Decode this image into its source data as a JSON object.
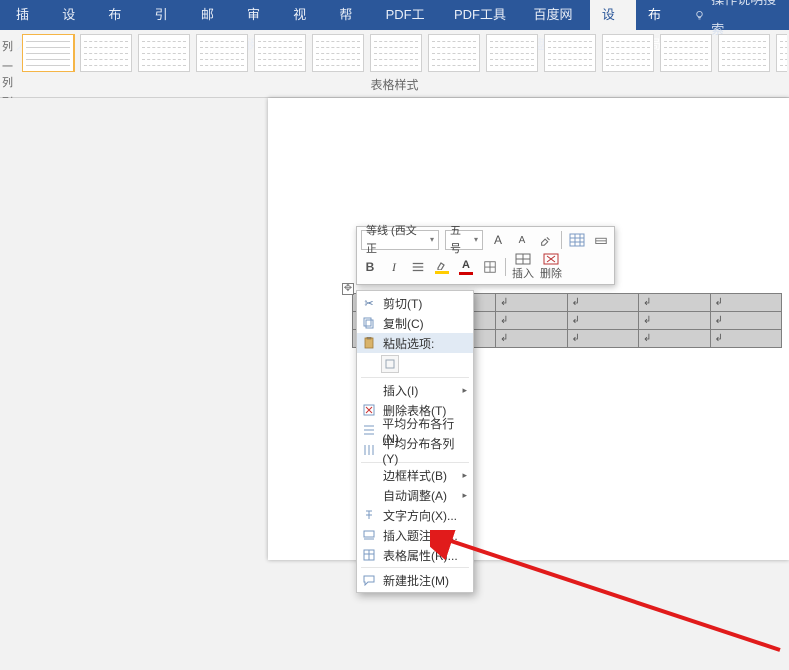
{
  "tabs": {
    "insert": "插入",
    "design_main": "设计",
    "layout_main": "布局",
    "references": "引用",
    "mailings": "邮件",
    "review": "审阅",
    "view": "视图",
    "help": "帮助",
    "pdf_tools": "PDF工具",
    "pdf_toolset": "PDF工具集",
    "baidu": "百度网盘",
    "table_design": "设计",
    "table_layout": "布局",
    "search_label": "操作说明搜索"
  },
  "sidelabels": {
    "l0": "列",
    "l1": "一列",
    "l2": "列"
  },
  "gallery_group_label": "表格样式",
  "mini": {
    "font_name": "等线 (西文正",
    "font_size": "五号",
    "insert_label": "插入",
    "delete_label": "删除",
    "bold": "B",
    "italic": "I",
    "a_large": "A",
    "a_small": "A"
  },
  "context_menu": {
    "cut": "剪切(T)",
    "copy": "复制(C)",
    "paste_options": "粘贴选项:",
    "insert": "插入(I)",
    "delete_table": "删除表格(T)",
    "distribute_rows": "平均分布各行(N)",
    "distribute_cols": "平均分布各列(Y)",
    "border_styles": "边框样式(B)",
    "autofit": "自动调整(A)",
    "text_direction": "文字方向(X)...",
    "insert_caption": "插入题注(C)...",
    "table_properties": "表格属性(R)...",
    "new_comment": "新建批注(M)"
  },
  "table": {
    "cell_marker": "↲"
  }
}
